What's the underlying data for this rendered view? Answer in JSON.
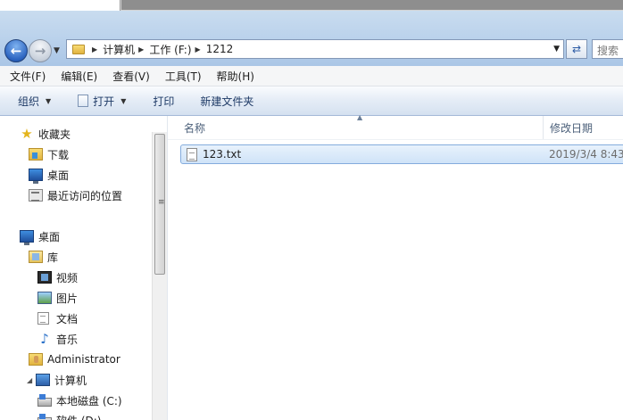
{
  "address": {
    "crumbs": [
      "计算机",
      "工作 (F:)",
      "1212"
    ],
    "search_placeholder": "搜索"
  },
  "menu": [
    "文件(F)",
    "编辑(E)",
    "查看(V)",
    "工具(T)",
    "帮助(H)"
  ],
  "commands": {
    "organize": "组织",
    "open": "打开",
    "print": "打印",
    "new_folder": "新建文件夹"
  },
  "nav": {
    "favorites": "收藏夹",
    "downloads": "下载",
    "fav_desktop": "桌面",
    "recent": "最近访问的位置",
    "desktop": "桌面",
    "libraries": "库",
    "videos": "视频",
    "pictures": "图片",
    "documents": "文档",
    "music": "音乐",
    "admin": "Administrator",
    "computer": "计算机",
    "drive_c": "本地磁盘 (C:)",
    "drive_d": "软件 (D:)"
  },
  "columns": {
    "name": "名称",
    "date": "修改日期"
  },
  "files": [
    {
      "name": "123.txt",
      "modified": "2019/3/4 8:43"
    }
  ]
}
